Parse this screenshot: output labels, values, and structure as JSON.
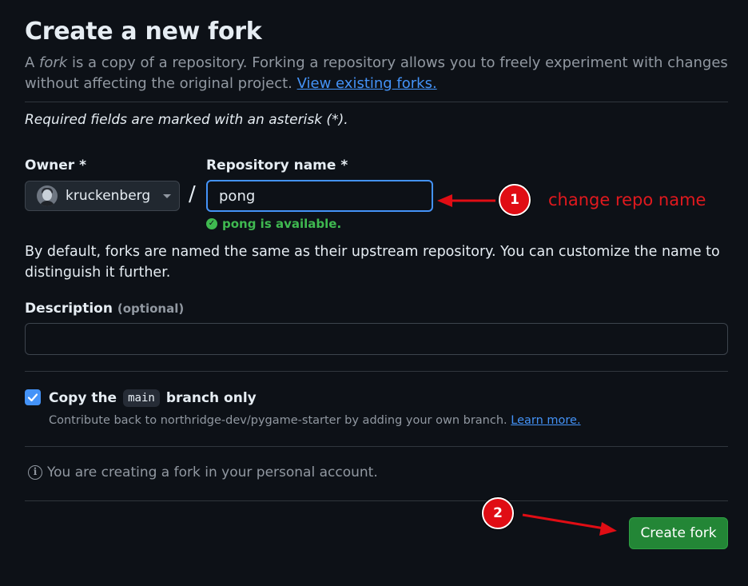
{
  "header": {
    "title": "Create a new fork",
    "intro_prefix": "A ",
    "intro_em": "fork",
    "intro_rest": " is a copy of a repository. Forking a repository allows you to freely experiment with changes without affecting the original project. ",
    "view_forks_link": "View existing forks."
  },
  "form": {
    "required_note": "Required fields are marked with an asterisk (*).",
    "owner_label": "Owner *",
    "owner_value": "kruckenberg",
    "separator": "/",
    "repo_label": "Repository name *",
    "repo_value": "pong",
    "availability": "pong is available.",
    "default_help": "By default, forks are named the same as their upstream repository. You can customize the name to distinguish it further.",
    "description_label": "Description",
    "description_optional": "(optional)",
    "description_value": "",
    "copy_branch_prefix": "Copy the",
    "copy_branch_name": "main",
    "copy_branch_suffix": "branch only",
    "copy_branch_checked": true,
    "copy_help": "Contribute back to northridge-dev/pygame-starter by adding your own branch. ",
    "learn_more": "Learn more.",
    "notice": "You are creating a fork in your personal account.",
    "create_button": "Create fork"
  },
  "annotations": {
    "badge_1": "1",
    "badge_2": "2",
    "note_1": "change repo name",
    "color": "#e00d14"
  },
  "colors": {
    "background": "#0d1117",
    "accent": "#4493f8",
    "success": "#3fb950",
    "primary_button": "#238636"
  },
  "icons": {
    "availability": "check-circle-icon",
    "notice": "info-icon",
    "owner_dropdown": "caret-down-icon"
  }
}
